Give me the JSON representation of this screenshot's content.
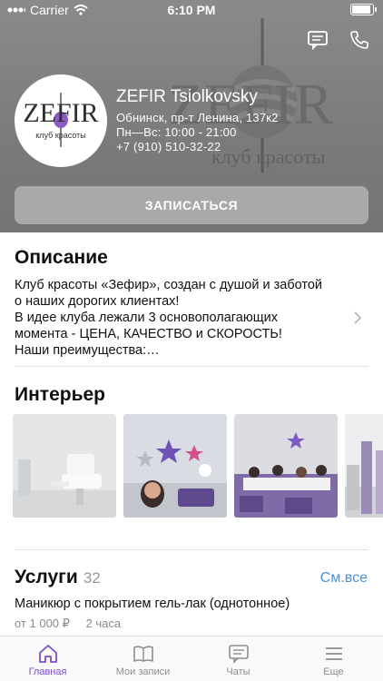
{
  "status_bar": {
    "carrier": "Carrier",
    "time": "6:10 PM",
    "battery_level": 1.0
  },
  "header": {
    "watermark_text": "ZEFIR",
    "watermark_sub": "клуб красоты",
    "logo_text": "ZEFIR",
    "logo_sub": "клуб красоты",
    "salon_name": "ZEFIR Tsiolkovsky",
    "address": "Обнинск, пр-т Ленина, 137к2",
    "hours": "Пн—Вс: 10:00 - 21:00",
    "phone": "+7 (910) 510-32-22",
    "book_label": "ЗАПИСАТЬСЯ",
    "icons": {
      "chat": "chat-bubble-icon",
      "call": "phone-icon"
    }
  },
  "description": {
    "title": "Описание",
    "lines": [
      "Клуб красоты «Зефир», создан с душой и заботой",
      "о наших дорогих клиентах!",
      "В идее клуба лежали 3 основополагающих",
      "момента - ЦЕНА, КАЧЕСТВО и СКОРОСТЬ!",
      "Наши преимущества:…"
    ]
  },
  "interior": {
    "title": "Интерьер",
    "photos": [
      "pedicure-room-photo",
      "lounge-balloons-photo",
      "manicure-hall-photo",
      "hallway-photo"
    ]
  },
  "services": {
    "title": "Услуги",
    "count": "32",
    "see_all": "См.все",
    "items": [
      {
        "name": "Маникюр с покрытием гель-лак (однотонное)",
        "price": "от 1 000 ₽",
        "duration": "2 часа"
      }
    ]
  },
  "tabbar": {
    "tabs": [
      {
        "label": "Главная",
        "icon": "home-icon",
        "active": true
      },
      {
        "label": "Мои записи",
        "icon": "book-icon",
        "active": false
      },
      {
        "label": "Чаты",
        "icon": "chat-icon",
        "active": false
      },
      {
        "label": "Еще",
        "icon": "menu-icon",
        "active": false
      }
    ]
  },
  "colors": {
    "accent": "#7a50c9",
    "link": "#4a90d9",
    "header_bg": "#7f7f7f",
    "button_bg": "#a9a9a9"
  }
}
